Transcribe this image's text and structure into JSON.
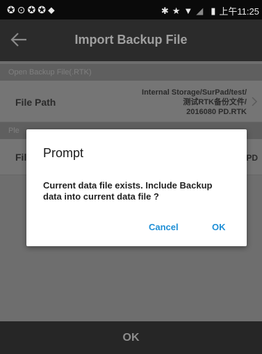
{
  "status_bar": {
    "left_icons": [
      "notification-icon",
      "sync-icon",
      "notification-icon",
      "notification-icon",
      "location-icon"
    ],
    "right_icons": [
      "bluetooth-icon",
      "star-icon",
      "wifi-icon",
      "signal-icon",
      "battery-icon"
    ],
    "time": "上午11:25"
  },
  "app_bar": {
    "title": "Import Backup File",
    "back_icon": "arrow-left-icon"
  },
  "sections": [
    {
      "header": "Open Backup File(.RTK)",
      "row_label": "File Path",
      "row_value_lines": [
        "Internal Storage/SurPad/test/",
        "测试RTK备份文件/",
        "2016080 PD.RTK"
      ]
    },
    {
      "header": "Ple",
      "row_label": "Fil",
      "row_value_lines": [
        "PD"
      ]
    }
  ],
  "dialog": {
    "title": "Prompt",
    "message": "Current data file exists. Include Backup data into current data file ?",
    "cancel_label": "Cancel",
    "ok_label": "OK"
  },
  "bottom_bar": {
    "ok_label": "OK"
  },
  "colors": {
    "accent": "#1e8fd6",
    "app_bar": "#2b2b2b",
    "status_bar": "#0a0a0a"
  }
}
